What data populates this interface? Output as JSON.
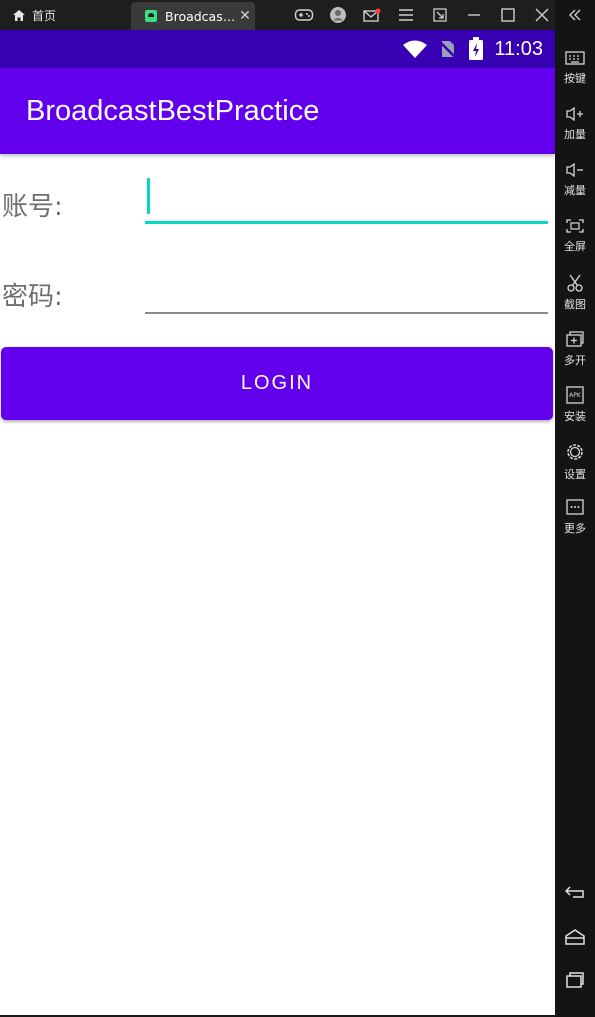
{
  "emulator": {
    "home_tab_label": "首页",
    "app_tab_label": "Broadcas…",
    "app_tab_close": "✕",
    "toolbar_icons": [
      "gamepad-icon",
      "account-icon",
      "mail-icon",
      "menu-icon",
      "popout-icon",
      "minimize-icon",
      "maximize-icon",
      "close-icon"
    ],
    "sidebar": [
      {
        "label": "按键",
        "icon": "keyboard-icon"
      },
      {
        "label": "加量",
        "icon": "volume-up-icon"
      },
      {
        "label": "减量",
        "icon": "volume-down-icon"
      },
      {
        "label": "全屏",
        "icon": "fullscreen-icon"
      },
      {
        "label": "截图",
        "icon": "scissors-icon"
      },
      {
        "label": "多开",
        "icon": "multi-instance-icon"
      },
      {
        "label": "安装",
        "icon": "apk-install-icon"
      },
      {
        "label": "设置",
        "icon": "gear-icon"
      },
      {
        "label": "更多",
        "icon": "more-icon"
      }
    ],
    "nav_buttons": [
      "back-icon",
      "home-icon",
      "recents-icon"
    ]
  },
  "statusbar": {
    "time": "11:03",
    "icons": [
      "wifi-icon",
      "no-sim-icon",
      "battery-icon"
    ]
  },
  "appbar": {
    "title": "BroadcastBestPractice"
  },
  "form": {
    "account_label": "账号:",
    "account_value": "",
    "password_label": "密码:",
    "password_value": "",
    "login_button": "LOGIN"
  },
  "colors": {
    "primary": "#6200ee",
    "primary_dark": "#3700b3",
    "accent": "#03dac5"
  }
}
